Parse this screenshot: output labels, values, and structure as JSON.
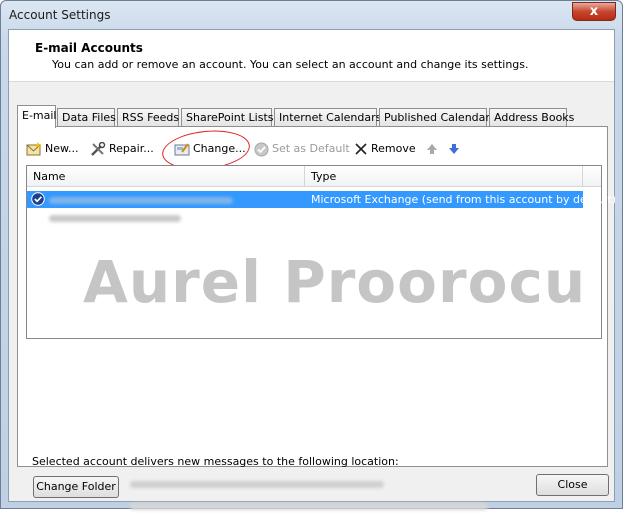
{
  "window": {
    "title": "Account Settings",
    "close_glyph": "x"
  },
  "header": {
    "title": "E-mail Accounts",
    "subtitle": "You can add or remove an account. You can select an account and change its settings."
  },
  "tabs": [
    {
      "label": "E-mail",
      "active": true
    },
    {
      "label": "Data Files"
    },
    {
      "label": "RSS Feeds"
    },
    {
      "label": "SharePoint Lists"
    },
    {
      "label": "Internet Calendars"
    },
    {
      "label": "Published Calendars"
    },
    {
      "label": "Address Books"
    }
  ],
  "toolbar": {
    "new_label": "New...",
    "repair_label": "Repair...",
    "change_label": "Change...",
    "set_default_label": "Set as Default",
    "remove_label": "Remove"
  },
  "accounts": {
    "columns": [
      "Name",
      "Type"
    ],
    "rows": [
      {
        "name": "",
        "type": "Microsoft Exchange (send from this account by default)",
        "selected": true
      },
      {
        "name": "",
        "type": "",
        "selected": false
      }
    ]
  },
  "watermark": "Aurel Proorocu",
  "delivery": {
    "text": "Selected account delivers new messages to the following location:",
    "change_folder_label": "Change Folder"
  },
  "footer": {
    "close_label": "Close"
  },
  "colors": {
    "selection": "#3399ff",
    "annotation": "#e02020"
  }
}
